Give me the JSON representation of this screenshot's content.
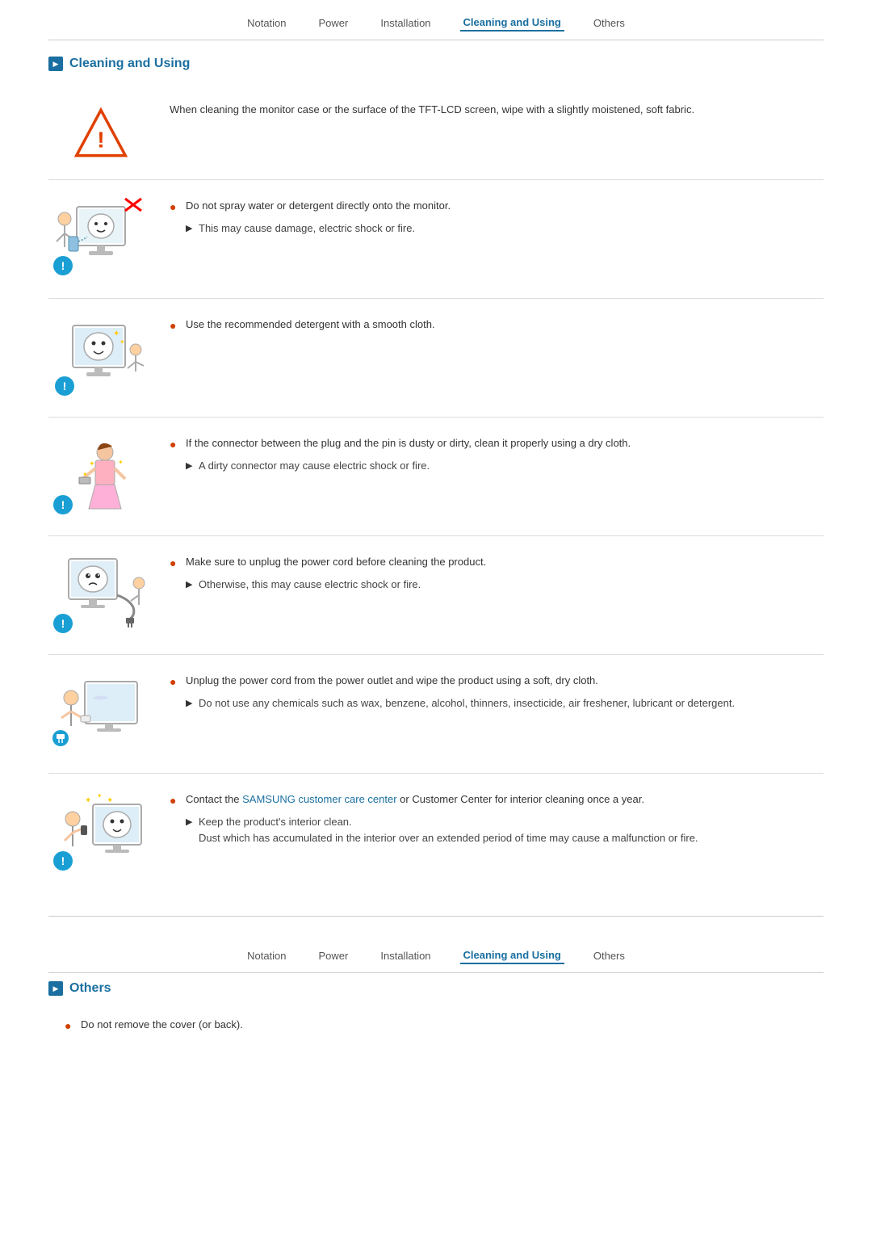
{
  "nav": {
    "items": [
      {
        "label": "Notation",
        "active": false
      },
      {
        "label": "Power",
        "active": false
      },
      {
        "label": "Installation",
        "active": false
      },
      {
        "label": "Cleaning and Using",
        "active": true
      },
      {
        "label": "Others",
        "active": false
      }
    ]
  },
  "nav2": {
    "items": [
      {
        "label": "Notation",
        "active": false
      },
      {
        "label": "Power",
        "active": false
      },
      {
        "label": "Installation",
        "active": false
      },
      {
        "label": "Cleaning and Using",
        "active": true
      },
      {
        "label": "Others",
        "active": false
      }
    ]
  },
  "section1": {
    "title": "Cleaning and Using",
    "intro": "When cleaning the monitor case or the surface of the TFT-LCD screen, wipe with a slightly moistened, soft fabric.",
    "blocks": [
      {
        "primary": "Do not spray water or detergent directly onto the monitor.",
        "secondary": "This may cause damage, electric shock or fire."
      },
      {
        "primary": "Use the recommended detergent with a smooth cloth.",
        "secondary": ""
      },
      {
        "primary": "If the connector between the plug and the pin is dusty or dirty, clean it properly using a dry cloth.",
        "secondary": "A dirty connector may cause electric shock or fire."
      },
      {
        "primary": "Make sure to unplug the power cord before cleaning the product.",
        "secondary": "Otherwise, this may cause electric shock or fire."
      },
      {
        "primary": "Unplug the power cord from the power outlet and wipe the product using a soft, dry cloth.",
        "secondary": "Do not use any chemicals such as wax, benzene, alcohol, thinners, insecticide, air freshener, lubricant or detergent."
      },
      {
        "primary": "Contact the SAMSUNG customer care center or Customer Center for interior cleaning once a year.",
        "secondary_multi": [
          "Keep the product's interior clean.",
          "Dust which has accumulated in the interior over an extended period of time may cause a malfunction or fire."
        ],
        "link_text": "SAMSUNG customer care center"
      }
    ]
  },
  "section2": {
    "title": "Others",
    "blocks": [
      {
        "primary": "Do not remove the cover (or back).",
        "secondary": ""
      }
    ]
  }
}
